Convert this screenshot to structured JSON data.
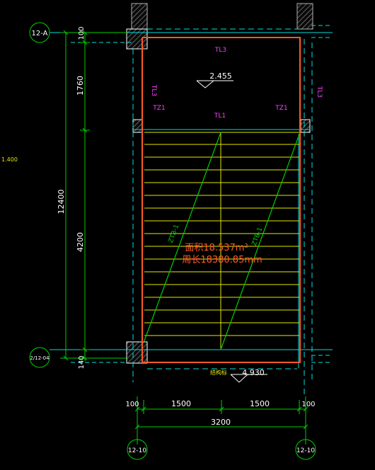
{
  "axes": {
    "top_left": "12-A",
    "bottom_left": "2/12-04",
    "bottom_1": "12-10",
    "bottom_2": "12-10"
  },
  "dims": {
    "overall_vertical": "12400",
    "seg_top": "100",
    "seg_upper": "1760",
    "seg_lower": "4200",
    "seg_bottom": "140",
    "bottom_left_100": "100",
    "bottom_1500_a": "1500",
    "bottom_1500_b": "1500",
    "bottom_right_100": "100",
    "bottom_total": "3200"
  },
  "labels": {
    "tl3_top": "TL3",
    "tl3_left": "TL3",
    "tl3_right": "TL3",
    "tz1_left": "TZ1",
    "tz1_right": "TZ1",
    "tl1": "TL1",
    "elev_top": "2.455",
    "elev_bottom": "4.930",
    "elev_bottom_tag": "结构标",
    "flight_left": "ZTB-1",
    "flight_right": "ZTB-1",
    "area": "面积18.537m²",
    "perimeter": "周长18380.85mm",
    "left_edge_text": "1.400"
  },
  "colors": {
    "dim_green": "#00d000",
    "axis_line": "#00e0e0",
    "outline": "#ff5a2a",
    "tread": "#e6e600",
    "magenta": "#ff40ff",
    "white": "#ffffff",
    "wall": "#808080"
  }
}
